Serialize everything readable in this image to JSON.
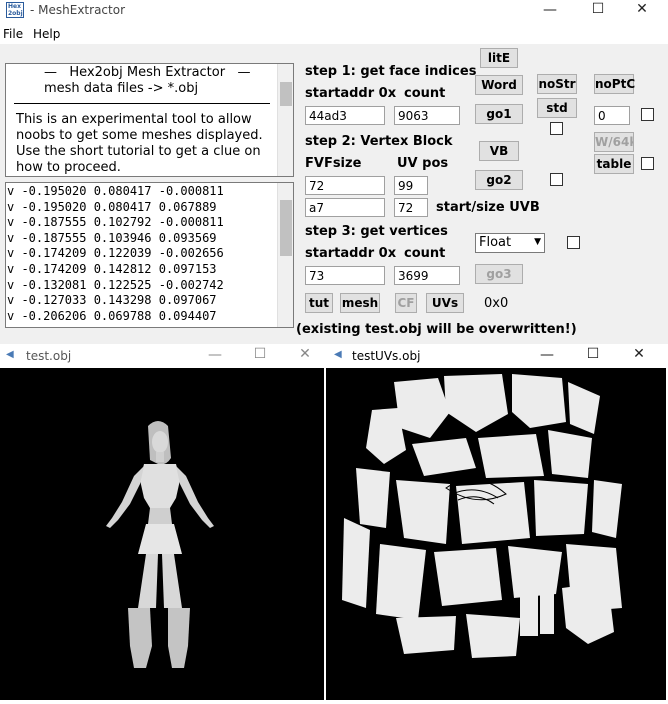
{
  "app": {
    "logo_text": "Hex2obj",
    "title": "MeshExtractor",
    "title_separator": "- "
  },
  "menu": {
    "file": "File",
    "help": "Help"
  },
  "about": {
    "line1": "—   Hex2obj Mesh Extractor   —",
    "line2": "mesh data files -> *.obj",
    "body": "This is an experimental tool to allow\nnoobs to get some meshes displayed.\nUse the short tutorial to get a clue on\nhow to proceed."
  },
  "vertices": [
    "v -0.195020 0.080417 -0.000811",
    "v -0.195020 0.080417 0.067889",
    "v -0.187555 0.102792 -0.000811",
    "v -0.187555 0.103946 0.093569",
    "v -0.174209 0.122039 -0.002656",
    "v -0.174209 0.142812 0.097153",
    "v -0.132081 0.122525 -0.002742",
    "v -0.127033 0.143298 0.097067",
    "v -0.206206 0.069788 0.094407"
  ],
  "step1": {
    "title": "step 1: get face indices",
    "startaddr_label": "startaddr 0x",
    "count_label": "count",
    "startaddr_value": "44ad3",
    "count_value": "9063"
  },
  "step2": {
    "title": "step 2: Vertex Block",
    "fvf_label": "FVFsize",
    "uvpos_label": "UV pos",
    "fvf_value": "72",
    "uvpos_value": "99",
    "start_uvb_value": "a7",
    "size_uvb_value": "72",
    "start_size_label": "start/size UVB"
  },
  "step3": {
    "title": "step 3: get vertices",
    "startaddr_label": "startaddr 0x",
    "count_label": "count",
    "startaddr_value": "73",
    "count_value": "3699"
  },
  "buttons": {
    "lite": "litE",
    "word": "Word",
    "go1": "go1",
    "vb": "VB",
    "go2": "go2",
    "go3": "go3",
    "nostr": "noStr",
    "std": "std",
    "noptc": "noPtC",
    "w64": "W/64k",
    "table": "table",
    "tut": "tut",
    "mesh": "mesh",
    "cf": "CF",
    "uvs": "UVs"
  },
  "ptc_value": "0",
  "float_select": "Float",
  "hex_readout": "0x0",
  "overwrite_note": "(existing test.obj will be overwritten!)",
  "windows": {
    "test_obj": "test.obj",
    "test_uvs": "testUVs.obj"
  },
  "colors": {
    "background": "#f0f0f0",
    "viewport": "#000000",
    "mesh": "#d9d9d9"
  }
}
